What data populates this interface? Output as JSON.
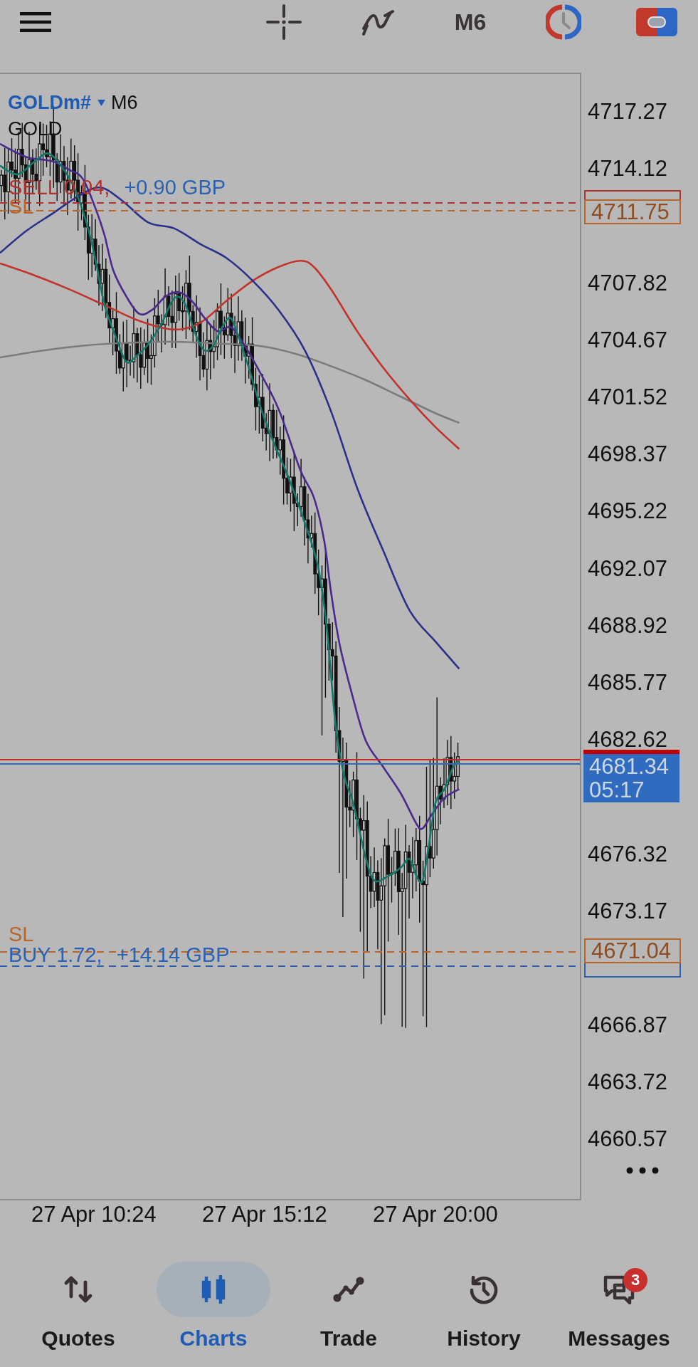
{
  "toolbar": {
    "timeframe": "M6"
  },
  "chart": {
    "symbol": "GOLDm#",
    "timeframe": "M6",
    "description": "GOLD"
  },
  "orders": [
    {
      "kind": "sell",
      "label": "SELL 0.04,",
      "profit": "+0.90 GBP",
      "stop_loss": {
        "label": "SL",
        "price": "4711.75"
      }
    },
    {
      "kind": "buy",
      "label": "BUY 1.72,",
      "profit": "+14.14 GBP",
      "stop_loss": {
        "label": "SL",
        "price": "4671.04"
      }
    }
  ],
  "price_axis": [
    "4717.27",
    "4714.12",
    "4707.82",
    "4704.67",
    "4701.52",
    "4698.37",
    "4695.22",
    "4692.07",
    "4688.92",
    "4685.77",
    "4682.62",
    "4676.32",
    "4673.17",
    "4666.87",
    "4663.72",
    "4660.57"
  ],
  "current_price": {
    "bid": "4681.34",
    "countdown": "05:17"
  },
  "time_axis": [
    "27 Apr 10:24",
    "27 Apr 15:12",
    "27 Apr 20:00"
  ],
  "nav": [
    {
      "label": "Quotes",
      "selected": false
    },
    {
      "label": "Charts",
      "selected": true
    },
    {
      "label": "Trade",
      "selected": false
    },
    {
      "label": "History",
      "selected": false
    },
    {
      "label": "Messages",
      "selected": false,
      "badge": "3"
    }
  ]
}
